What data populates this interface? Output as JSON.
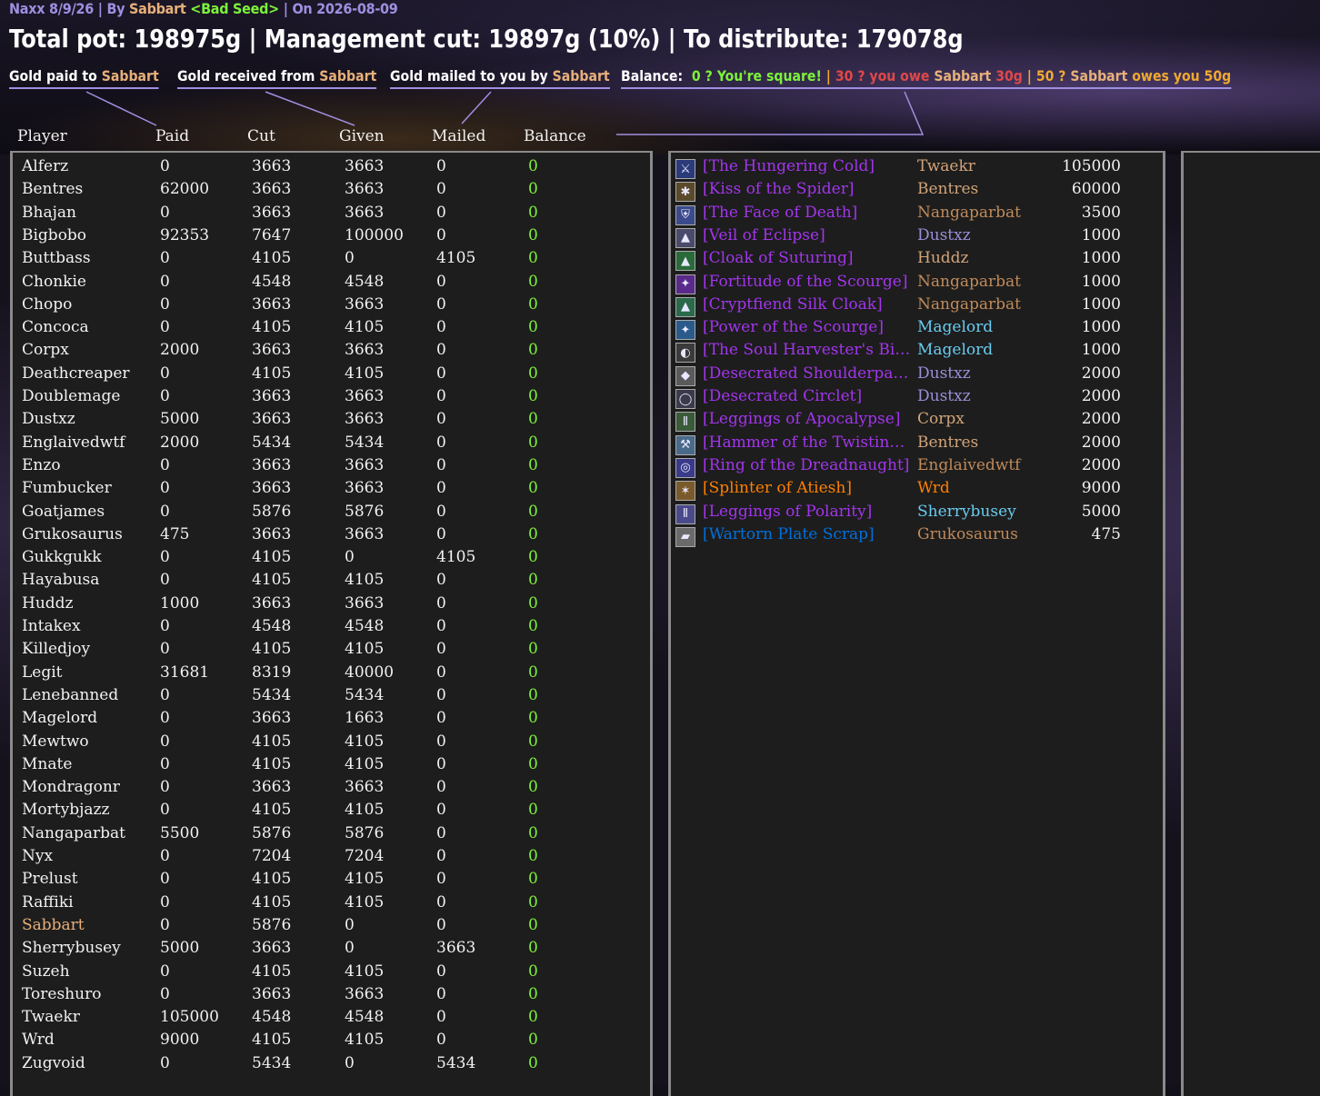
{
  "header": {
    "subtitle_prefix": "Naxx 8/9/26 | By ",
    "subtitle_name": "Sabbart",
    "subtitle_guild": "<Bad Seed>",
    "subtitle_suffix": " | On 2026-08-09",
    "title": "Total pot: 198975g | Management cut: 19897g (10%) | To distribute: 179078g"
  },
  "legend": {
    "paid_prefix": "Gold paid to ",
    "received_prefix": "Gold received from ",
    "mailed_prefix": "Gold mailed to you by ",
    "name": "Sabbart",
    "balance_label": "Balance:",
    "square": "0 ? You're square!",
    "sep1": " | ",
    "owe_prefix": "30 ? you owe ",
    "owe_name": "Sabbart",
    "owe_suffix": " 30g",
    "sep2": " | ",
    "owes_prefix": "50 ? ",
    "owes_name": "Sabbart",
    "owes_suffix": " owes you 50g"
  },
  "columns": {
    "player": "Player",
    "paid": "Paid",
    "cut": "Cut",
    "given": "Given",
    "mailed": "Mailed",
    "balance": "Balance"
  },
  "colors": {
    "accent": "#9f8fe0",
    "name": "#e8b07a",
    "balance_zero": "#7cf23a",
    "owe": "#e04848",
    "owes": "#f0a830"
  },
  "players": [
    {
      "name": "Alferz",
      "paid": "0",
      "cut": "3663",
      "given": "3663",
      "mailed": "0",
      "balance": "0"
    },
    {
      "name": "Bentres",
      "paid": "62000",
      "cut": "3663",
      "given": "3663",
      "mailed": "0",
      "balance": "0"
    },
    {
      "name": "Bhajan",
      "paid": "0",
      "cut": "3663",
      "given": "3663",
      "mailed": "0",
      "balance": "0"
    },
    {
      "name": "Bigbobo",
      "paid": "92353",
      "cut": "7647",
      "given": "100000",
      "mailed": "0",
      "balance": "0"
    },
    {
      "name": "Buttbass",
      "paid": "0",
      "cut": "4105",
      "given": "0",
      "mailed": "4105",
      "balance": "0"
    },
    {
      "name": "Chonkie",
      "paid": "0",
      "cut": "4548",
      "given": "4548",
      "mailed": "0",
      "balance": "0"
    },
    {
      "name": "Chopo",
      "paid": "0",
      "cut": "3663",
      "given": "3663",
      "mailed": "0",
      "balance": "0"
    },
    {
      "name": "Concoca",
      "paid": "0",
      "cut": "4105",
      "given": "4105",
      "mailed": "0",
      "balance": "0"
    },
    {
      "name": "Corpx",
      "paid": "2000",
      "cut": "3663",
      "given": "3663",
      "mailed": "0",
      "balance": "0"
    },
    {
      "name": "Deathcreaper",
      "paid": "0",
      "cut": "4105",
      "given": "4105",
      "mailed": "0",
      "balance": "0"
    },
    {
      "name": "Doublemage",
      "paid": "0",
      "cut": "3663",
      "given": "3663",
      "mailed": "0",
      "balance": "0"
    },
    {
      "name": "Dustxz",
      "paid": "5000",
      "cut": "3663",
      "given": "3663",
      "mailed": "0",
      "balance": "0"
    },
    {
      "name": "Englaivedwtf",
      "paid": "2000",
      "cut": "5434",
      "given": "5434",
      "mailed": "0",
      "balance": "0"
    },
    {
      "name": "Enzo",
      "paid": "0",
      "cut": "3663",
      "given": "3663",
      "mailed": "0",
      "balance": "0"
    },
    {
      "name": "Fumbucker",
      "paid": "0",
      "cut": "3663",
      "given": "3663",
      "mailed": "0",
      "balance": "0"
    },
    {
      "name": "Goatjames",
      "paid": "0",
      "cut": "5876",
      "given": "5876",
      "mailed": "0",
      "balance": "0"
    },
    {
      "name": "Grukosaurus",
      "paid": "475",
      "cut": "3663",
      "given": "3663",
      "mailed": "0",
      "balance": "0"
    },
    {
      "name": "Gukkgukk",
      "paid": "0",
      "cut": "4105",
      "given": "0",
      "mailed": "4105",
      "balance": "0"
    },
    {
      "name": "Hayabusa",
      "paid": "0",
      "cut": "4105",
      "given": "4105",
      "mailed": "0",
      "balance": "0"
    },
    {
      "name": "Huddz",
      "paid": "1000",
      "cut": "3663",
      "given": "3663",
      "mailed": "0",
      "balance": "0"
    },
    {
      "name": "Intakex",
      "paid": "0",
      "cut": "4548",
      "given": "4548",
      "mailed": "0",
      "balance": "0"
    },
    {
      "name": "Killedjoy",
      "paid": "0",
      "cut": "4105",
      "given": "4105",
      "mailed": "0",
      "balance": "0"
    },
    {
      "name": "Legit",
      "paid": "31681",
      "cut": "8319",
      "given": "40000",
      "mailed": "0",
      "balance": "0"
    },
    {
      "name": "Lenebanned",
      "paid": "0",
      "cut": "5434",
      "given": "5434",
      "mailed": "0",
      "balance": "0"
    },
    {
      "name": "Magelord",
      "paid": "0",
      "cut": "3663",
      "given": "1663",
      "mailed": "0",
      "balance": "0"
    },
    {
      "name": "Mewtwo",
      "paid": "0",
      "cut": "4105",
      "given": "4105",
      "mailed": "0",
      "balance": "0"
    },
    {
      "name": "Mnate",
      "paid": "0",
      "cut": "4105",
      "given": "4105",
      "mailed": "0",
      "balance": "0"
    },
    {
      "name": "Mondragonr",
      "paid": "0",
      "cut": "3663",
      "given": "3663",
      "mailed": "0",
      "balance": "0"
    },
    {
      "name": "Mortybjazz",
      "paid": "0",
      "cut": "4105",
      "given": "4105",
      "mailed": "0",
      "balance": "0"
    },
    {
      "name": "Nangaparbat",
      "paid": "5500",
      "cut": "5876",
      "given": "5876",
      "mailed": "0",
      "balance": "0"
    },
    {
      "name": "Nyx",
      "paid": "0",
      "cut": "7204",
      "given": "7204",
      "mailed": "0",
      "balance": "0"
    },
    {
      "name": "Prelust",
      "paid": "0",
      "cut": "4105",
      "given": "4105",
      "mailed": "0",
      "balance": "0"
    },
    {
      "name": "Raffiki",
      "paid": "0",
      "cut": "4105",
      "given": "4105",
      "mailed": "0",
      "balance": "0"
    },
    {
      "name": "Sabbart",
      "paid": "0",
      "cut": "5876",
      "given": "0",
      "mailed": "0",
      "balance": "0",
      "highlight": "#e8b07a"
    },
    {
      "name": "Sherrybusey",
      "paid": "5000",
      "cut": "3663",
      "given": "0",
      "mailed": "3663",
      "balance": "0"
    },
    {
      "name": "Suzeh",
      "paid": "0",
      "cut": "4105",
      "given": "4105",
      "mailed": "0",
      "balance": "0"
    },
    {
      "name": "Toreshuro",
      "paid": "0",
      "cut": "3663",
      "given": "3663",
      "mailed": "0",
      "balance": "0"
    },
    {
      "name": "Twaekr",
      "paid": "105000",
      "cut": "4548",
      "given": "4548",
      "mailed": "0",
      "balance": "0"
    },
    {
      "name": "Wrd",
      "paid": "9000",
      "cut": "4105",
      "given": "4105",
      "mailed": "0",
      "balance": "0"
    },
    {
      "name": "Zugvoid",
      "paid": "0",
      "cut": "5434",
      "given": "0",
      "mailed": "5434",
      "balance": "0"
    }
  ],
  "items": [
    {
      "item": "[The Hungering Cold]",
      "item_color": "#a335ee",
      "winner": "Twaekr",
      "winner_color": "#d2a47a",
      "price": "105000",
      "icon": "blade-icon",
      "icon_bg": "#2a3a7a"
    },
    {
      "item": "[Kiss of the Spider]",
      "item_color": "#a335ee",
      "winner": "Bentres",
      "winner_color": "#d2a47a",
      "price": "60000",
      "icon": "spider-icon",
      "icon_bg": "#5a4a2a"
    },
    {
      "item": "[The Face of Death]",
      "item_color": "#a335ee",
      "winner": "Nangaparbat",
      "winner_color": "#c08a5a",
      "price": "3500",
      "icon": "shield-icon",
      "icon_bg": "#3a4a8a"
    },
    {
      "item": "[Veil of Eclipse]",
      "item_color": "#a335ee",
      "winner": "Dustxz",
      "winner_color": "#9a8fd8",
      "price": "1000",
      "icon": "cloak-icon",
      "icon_bg": "#4a4a6a"
    },
    {
      "item": "[Cloak of Suturing]",
      "item_color": "#a335ee",
      "winner": "Huddz",
      "winner_color": "#d2a47a",
      "price": "1000",
      "icon": "cloak-icon",
      "icon_bg": "#2a6a3a"
    },
    {
      "item": "[Fortitude of the Scourge]",
      "item_color": "#a335ee",
      "winner": "Nangaparbat",
      "winner_color": "#c08a5a",
      "price": "1000",
      "icon": "rune-icon",
      "icon_bg": "#5a2a8a"
    },
    {
      "item": "[Cryptfiend Silk Cloak]",
      "item_color": "#a335ee",
      "winner": "Nangaparbat",
      "winner_color": "#c08a5a",
      "price": "1000",
      "icon": "cloak-icon",
      "icon_bg": "#2a6a4a"
    },
    {
      "item": "[Power of the Scourge]",
      "item_color": "#a335ee",
      "winner": "Magelord",
      "winner_color": "#69ccf0",
      "price": "1000",
      "icon": "rune-icon",
      "icon_bg": "#2a5a8a"
    },
    {
      "item": "[The Soul Harvester's Bin...",
      "item_color": "#a335ee",
      "winner": "Magelord",
      "winner_color": "#69ccf0",
      "price": "1000",
      "icon": "bindings-icon",
      "icon_bg": "#3a3a3a"
    },
    {
      "item": "[Desecrated Shoulderpads]",
      "item_color": "#a335ee",
      "winner": "Dustxz",
      "winner_color": "#9a8fd8",
      "price": "2000",
      "icon": "shoulder-icon",
      "icon_bg": "#5a5a5a"
    },
    {
      "item": "[Desecrated Circlet]",
      "item_color": "#a335ee",
      "winner": "Dustxz",
      "winner_color": "#9a8fd8",
      "price": "2000",
      "icon": "circlet-icon",
      "icon_bg": "#3a3a4a"
    },
    {
      "item": "[Leggings of Apocalypse]",
      "item_color": "#a335ee",
      "winner": "Corpx",
      "winner_color": "#d2a47a",
      "price": "2000",
      "icon": "leggings-icon",
      "icon_bg": "#3a5a3a"
    },
    {
      "item": "[Hammer of the Twisting...",
      "item_color": "#a335ee",
      "winner": "Bentres",
      "winner_color": "#d2a47a",
      "price": "2000",
      "icon": "hammer-icon",
      "icon_bg": "#4a6a8a"
    },
    {
      "item": "[Ring of the Dreadnaught]",
      "item_color": "#a335ee",
      "winner": "Englaivedwtf",
      "winner_color": "#c08a5a",
      "price": "2000",
      "icon": "ring-icon",
      "icon_bg": "#3a3a8a"
    },
    {
      "item": "[Splinter of Atiesh]",
      "item_color": "#ff8000",
      "winner": "Wrd",
      "winner_color": "#ff8000",
      "price": "9000",
      "icon": "splinter-icon",
      "icon_bg": "#7a5a2a"
    },
    {
      "item": "[Leggings of Polarity]",
      "item_color": "#a335ee",
      "winner": "Sherrybusey",
      "winner_color": "#69ccf0",
      "price": "5000",
      "icon": "leggings-icon",
      "icon_bg": "#4a4a8a"
    },
    {
      "item": "[Wartorn Plate Scrap]",
      "item_color": "#0070dd",
      "winner": "Grukosaurus",
      "winner_color": "#c08a5a",
      "price": "475",
      "icon": "scrap-icon",
      "icon_bg": "#6a6a6a"
    }
  ]
}
